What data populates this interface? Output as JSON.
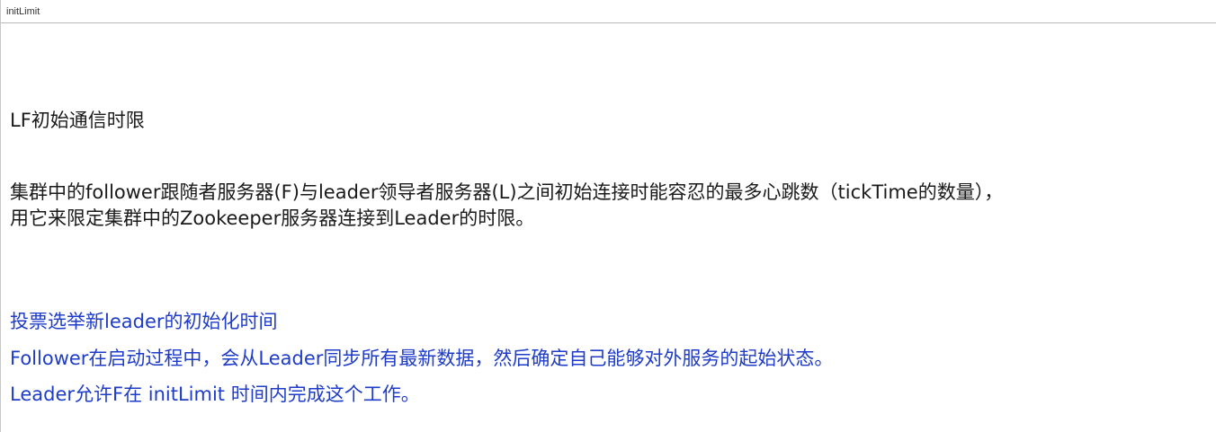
{
  "window": {
    "title": "initLimit"
  },
  "content": {
    "heading": "LF初始通信时限",
    "description_line1": "集群中的follower跟随者服务器(F)与leader领导者服务器(L)之间初始连接时能容忍的最多心跳数（tickTime的数量），",
    "description_line2": "用它来限定集群中的Zookeeper服务器连接到Leader的时限。",
    "note_line1": "投票选举新leader的初始化时间",
    "note_line2": "Follower在启动过程中，会从Leader同步所有最新数据，然后确定自己能够对外服务的起始状态。",
    "note_line3": "Leader允许F在 initLimit 时间内完成这个工作。"
  },
  "colors": {
    "text": "#1a1a1a",
    "note_text": "#1f3cc8",
    "title_border": "#b9b9b9"
  }
}
